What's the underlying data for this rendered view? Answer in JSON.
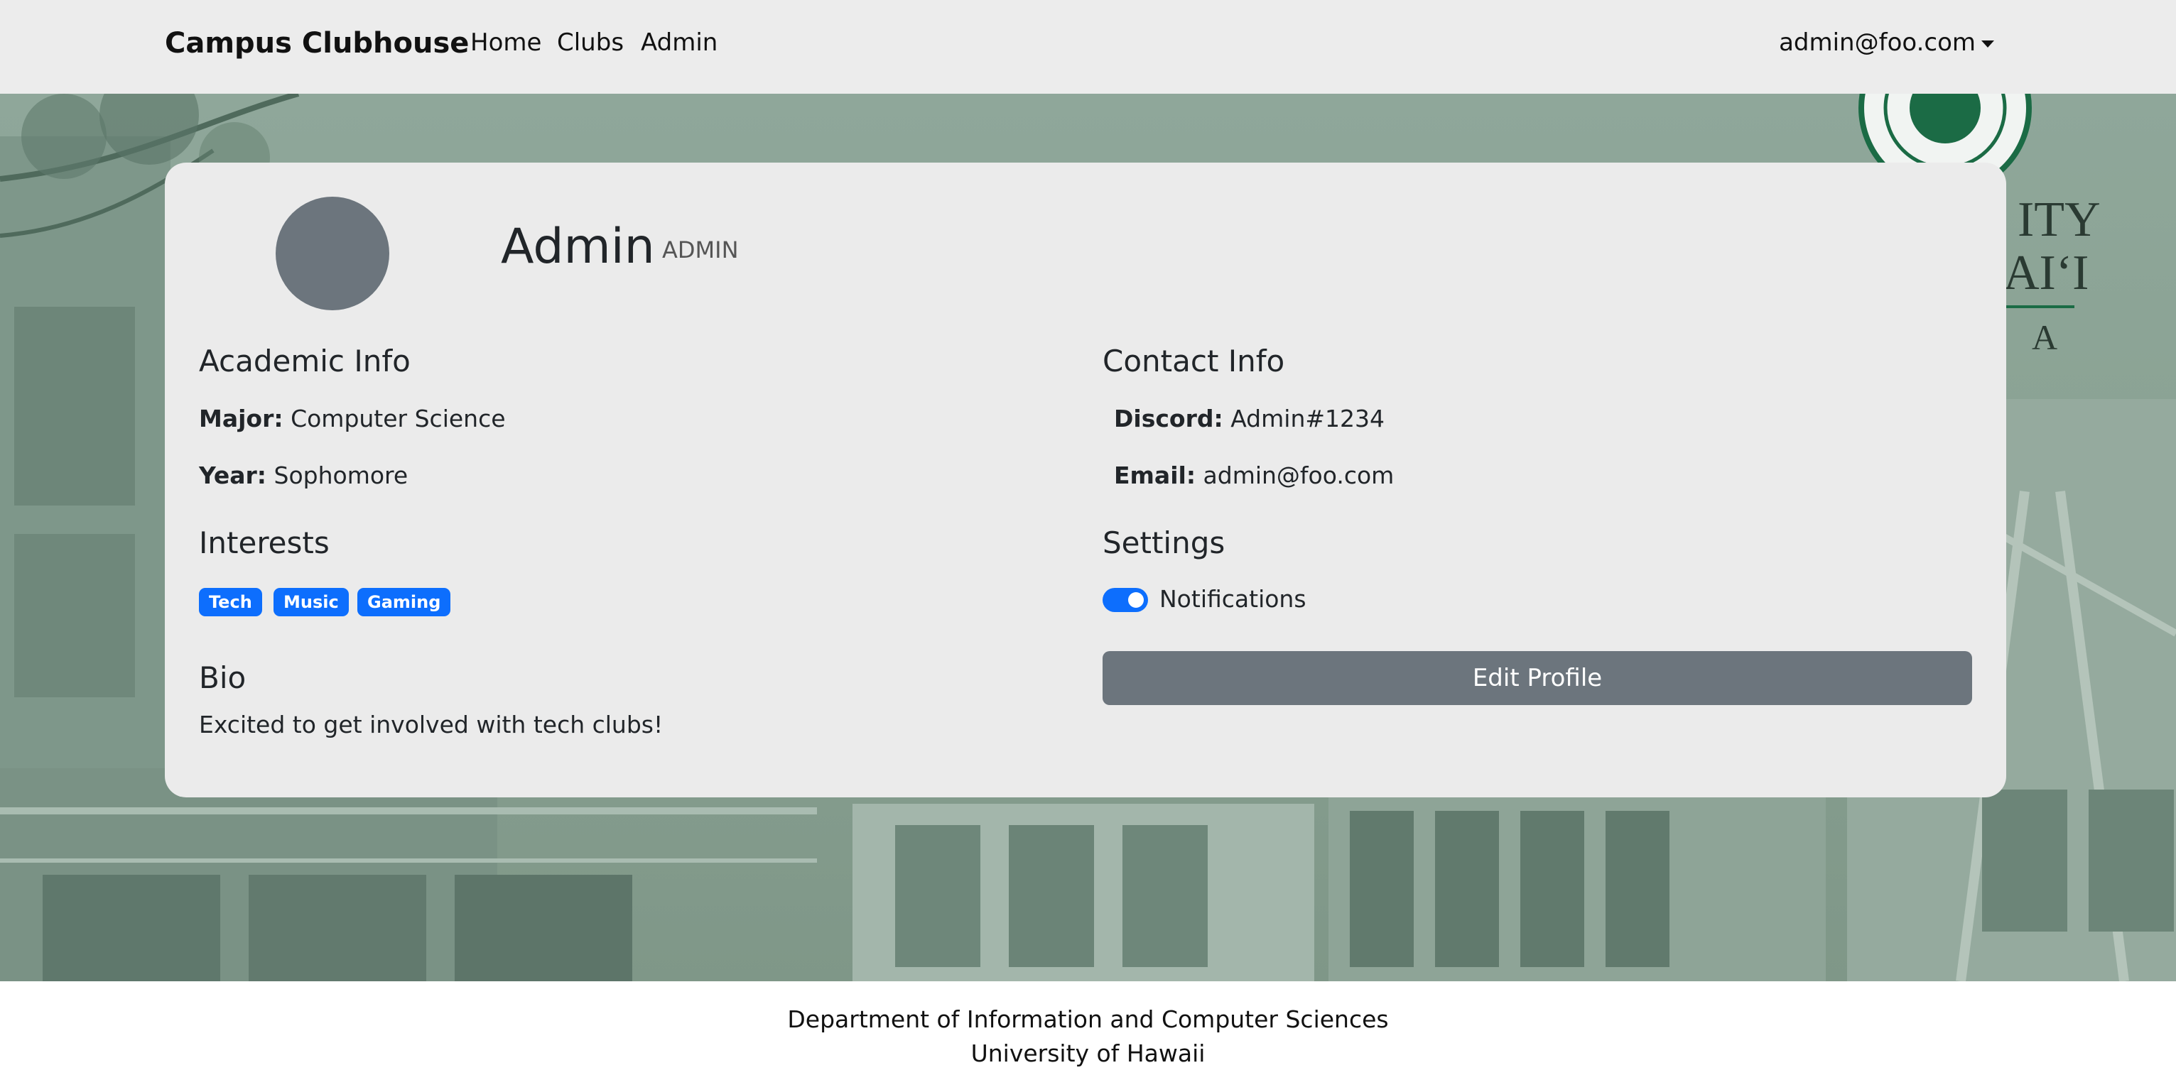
{
  "nav": {
    "brand": "Campus Clubhouse",
    "links": [
      "Home",
      "Clubs",
      "Admin"
    ],
    "user": "admin@foo.com"
  },
  "profile": {
    "name": "Admin",
    "role": "ADMIN",
    "academic": {
      "heading": "Academic Info",
      "major_label": "Major:",
      "major": "Computer Science",
      "year_label": "Year:",
      "year": "Sophomore"
    },
    "interests": {
      "heading": "Interests",
      "tags": [
        "Tech",
        "Music",
        "Gaming"
      ]
    },
    "bio": {
      "heading": "Bio",
      "text": "Excited to get involved with tech clubs!"
    },
    "contact": {
      "heading": "Contact Info",
      "discord_label": "Discord:",
      "discord": "Admin#1234",
      "email_label": "Email:",
      "email": "admin@foo.com"
    },
    "settings": {
      "heading": "Settings",
      "notifications_label": "Notifications",
      "notifications_enabled": true
    },
    "edit_button": "Edit Profile"
  },
  "footer": {
    "line1": "Department of Information and Computer Sciences",
    "line2": "University of Hawaii"
  },
  "colors": {
    "accent": "#0d6efd",
    "secondary": "#6c757d",
    "navbar_bg": "#ececec",
    "card_bg": "#ebebeb",
    "hero_tint": "#8fa79a"
  }
}
